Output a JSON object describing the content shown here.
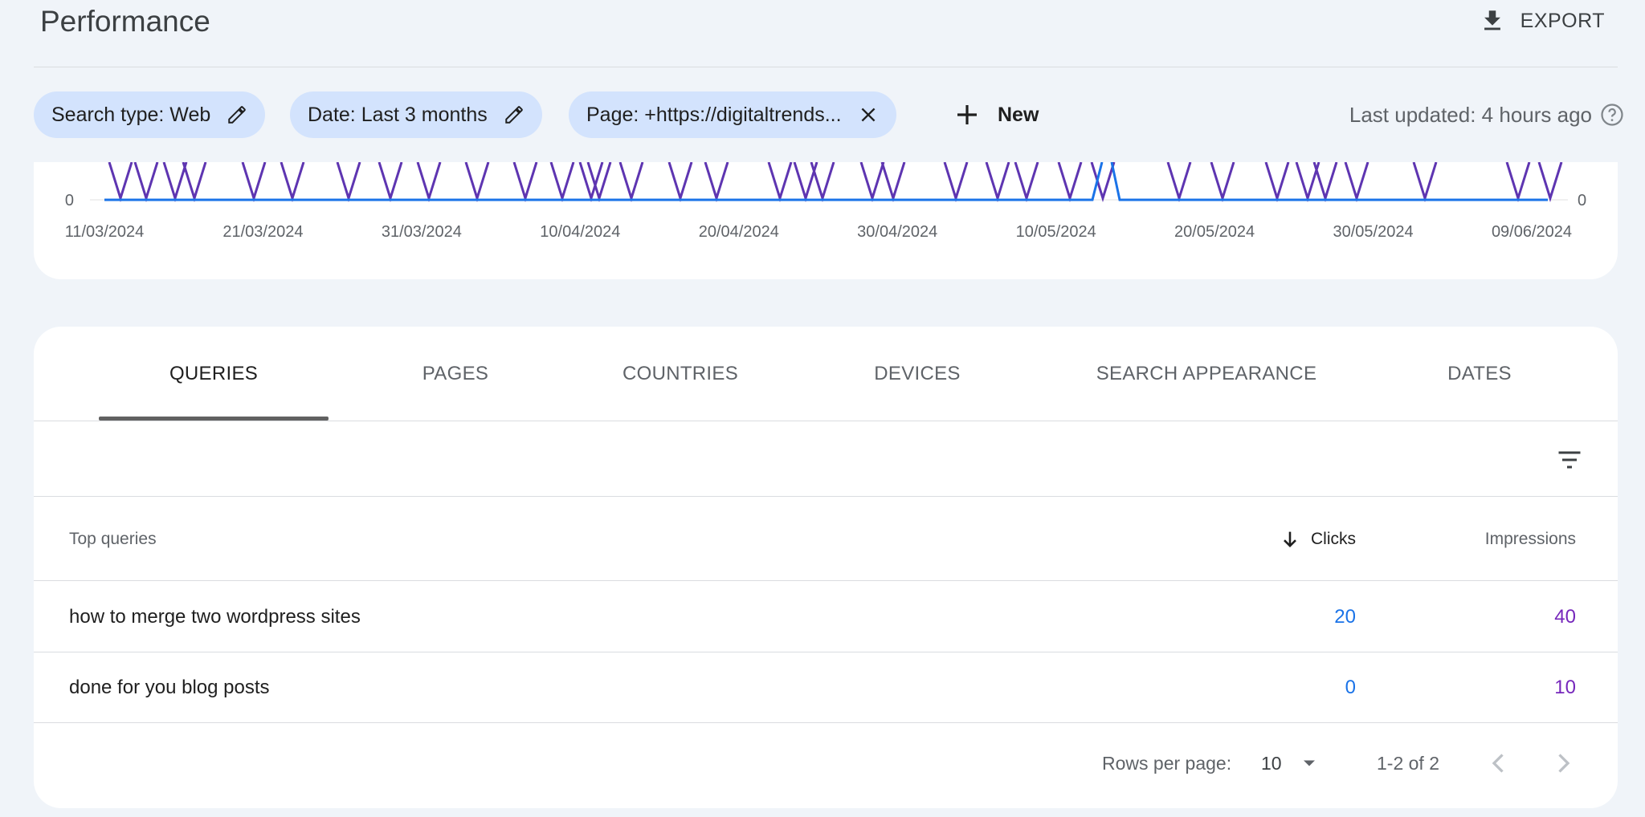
{
  "header": {
    "title": "Performance",
    "export_label": "EXPORT"
  },
  "filters": {
    "search_type": "Search type: Web",
    "date": "Date: Last 3 months",
    "page": "Page: +https://digitaltrends...",
    "new_label": "New",
    "last_updated": "Last updated: 4 hours ago"
  },
  "chart_data": {
    "type": "line",
    "y_left_tick": "0",
    "y_right_tick": "0",
    "x_ticks": [
      "11/03/2024",
      "21/03/2024",
      "31/03/2024",
      "10/04/2024",
      "20/04/2024",
      "30/04/2024",
      "10/05/2024",
      "20/05/2024",
      "30/05/2024",
      "09/06/2024"
    ],
    "series": [
      {
        "color": "#1a73e8"
      },
      {
        "color": "#5e35b1"
      }
    ]
  },
  "tabs": [
    {
      "label": "QUERIES",
      "active": true
    },
    {
      "label": "PAGES",
      "active": false
    },
    {
      "label": "COUNTRIES",
      "active": false
    },
    {
      "label": "DEVICES",
      "active": false
    },
    {
      "label": "SEARCH APPEARANCE",
      "active": false
    },
    {
      "label": "DATES",
      "active": false
    }
  ],
  "table": {
    "headers": {
      "query": "Top queries",
      "clicks": "Clicks",
      "impressions": "Impressions"
    },
    "rows": [
      {
        "query": "how to merge two wordpress sites",
        "clicks": "20",
        "impressions": "40"
      },
      {
        "query": "done for you blog posts",
        "clicks": "0",
        "impressions": "10"
      }
    ]
  },
  "pagination": {
    "rows_per_page_label": "Rows per page:",
    "rows_per_page_value": "10",
    "range": "1-2 of 2"
  },
  "colors": {
    "background": "#f0f4f9",
    "chip": "#d3e3fd",
    "clicks": "#1a73e8",
    "impressions": "#7627bb"
  },
  "icons": [
    "download-icon",
    "edit-icon",
    "close-icon",
    "add-icon",
    "help-icon",
    "filter-icon",
    "arrow-down-icon",
    "dropdown-icon",
    "chevron-left-icon",
    "chevron-right-icon"
  ]
}
